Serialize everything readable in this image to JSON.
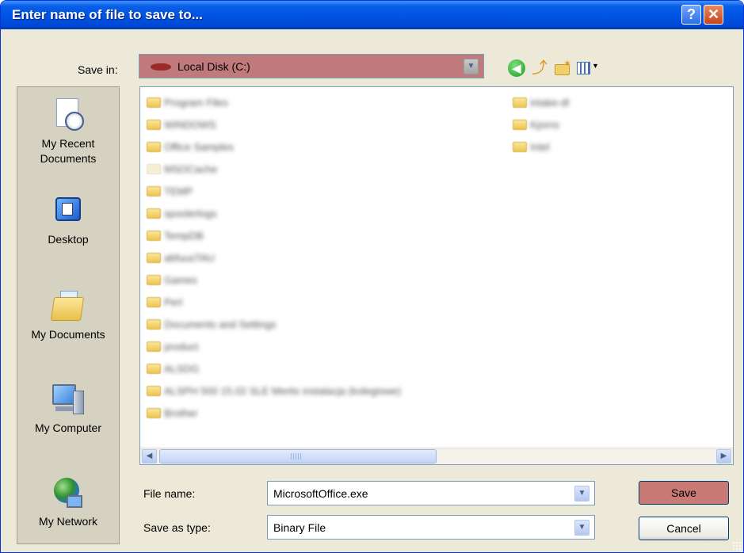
{
  "window": {
    "title": "Enter name of file to save to...",
    "help_glyph": "?",
    "close_glyph": "✕"
  },
  "save_in": {
    "label": "Save in:",
    "value": "Local Disk (C:)",
    "highlight_color": "#c17a7b"
  },
  "toolbar": {
    "back_icon": "back-arrow-icon",
    "up_icon": "up-folder-icon",
    "new_folder_icon": "new-folder-icon",
    "views_icon": "views-menu-icon"
  },
  "places": [
    {
      "label_line1": "My Recent",
      "label_line2": "Documents",
      "icon": "recent-documents-icon"
    },
    {
      "label_line1": "Desktop",
      "label_line2": "",
      "icon": "desktop-icon"
    },
    {
      "label_line1": "My Documents",
      "label_line2": "",
      "icon": "my-documents-icon"
    },
    {
      "label_line1": "My Computer",
      "label_line2": "",
      "icon": "my-computer-icon"
    },
    {
      "label_line1": "My Network",
      "label_line2": "",
      "icon": "my-network-icon"
    }
  ],
  "files": {
    "column1": [
      "Program Files",
      "WINDOWS",
      "Office Samples",
      "MSOCache",
      "TEMP",
      "spoolerlogs",
      "TempDB",
      "abfuusTAU",
      "Games",
      "Perl",
      "Documents and Settings",
      "product",
      "ALSDG",
      "ALSPH 500 15.02 SLE Merits instalacja (kolegiowe)",
      "Brother"
    ],
    "column2": [
      "intake-dl",
      "Kjorns",
      "Intel"
    ]
  },
  "file_name": {
    "label": "File name:",
    "value": "MicrosoftOffice.exe"
  },
  "save_as_type": {
    "label": "Save as type:",
    "value": "Binary File"
  },
  "buttons": {
    "save": "Save",
    "cancel": "Cancel"
  }
}
